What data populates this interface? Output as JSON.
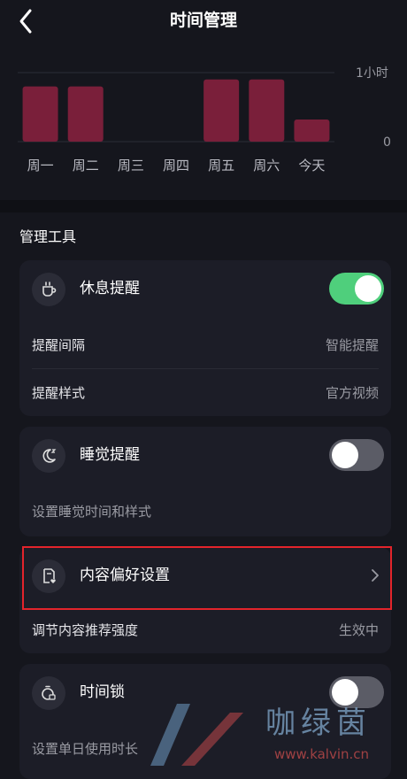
{
  "header": {
    "title": "时间管理"
  },
  "chart_data": {
    "type": "bar",
    "categories": [
      "周一",
      "周二",
      "周三",
      "周四",
      "周五",
      "周六",
      "今天"
    ],
    "values": [
      0.8,
      0.8,
      0,
      0,
      0.9,
      0.9,
      0.32
    ],
    "ylim": [
      0,
      1
    ],
    "ytick_labels": [
      "1小时",
      "0"
    ],
    "bar_color": "#7a1f3a",
    "grid": true
  },
  "section": {
    "title": "管理工具"
  },
  "rest_card": {
    "label": "休息提醒",
    "toggle_on": true,
    "rows": [
      {
        "label": "提醒间隔",
        "value": "智能提醒"
      },
      {
        "label": "提醒样式",
        "value": "官方视频"
      }
    ]
  },
  "sleep_card": {
    "label": "睡觉提醒",
    "toggle_on": false,
    "desc": "设置睡觉时间和样式"
  },
  "content_card": {
    "label": "内容偏好设置",
    "sub_label": "调节内容推荐强度",
    "sub_value": "生效中"
  },
  "lock_card": {
    "label": "时间锁",
    "toggle_on": false,
    "desc": "设置单日使用时长"
  },
  "watermark": {
    "text": "咖绿茵",
    "url": "www.kalvin.cn"
  }
}
